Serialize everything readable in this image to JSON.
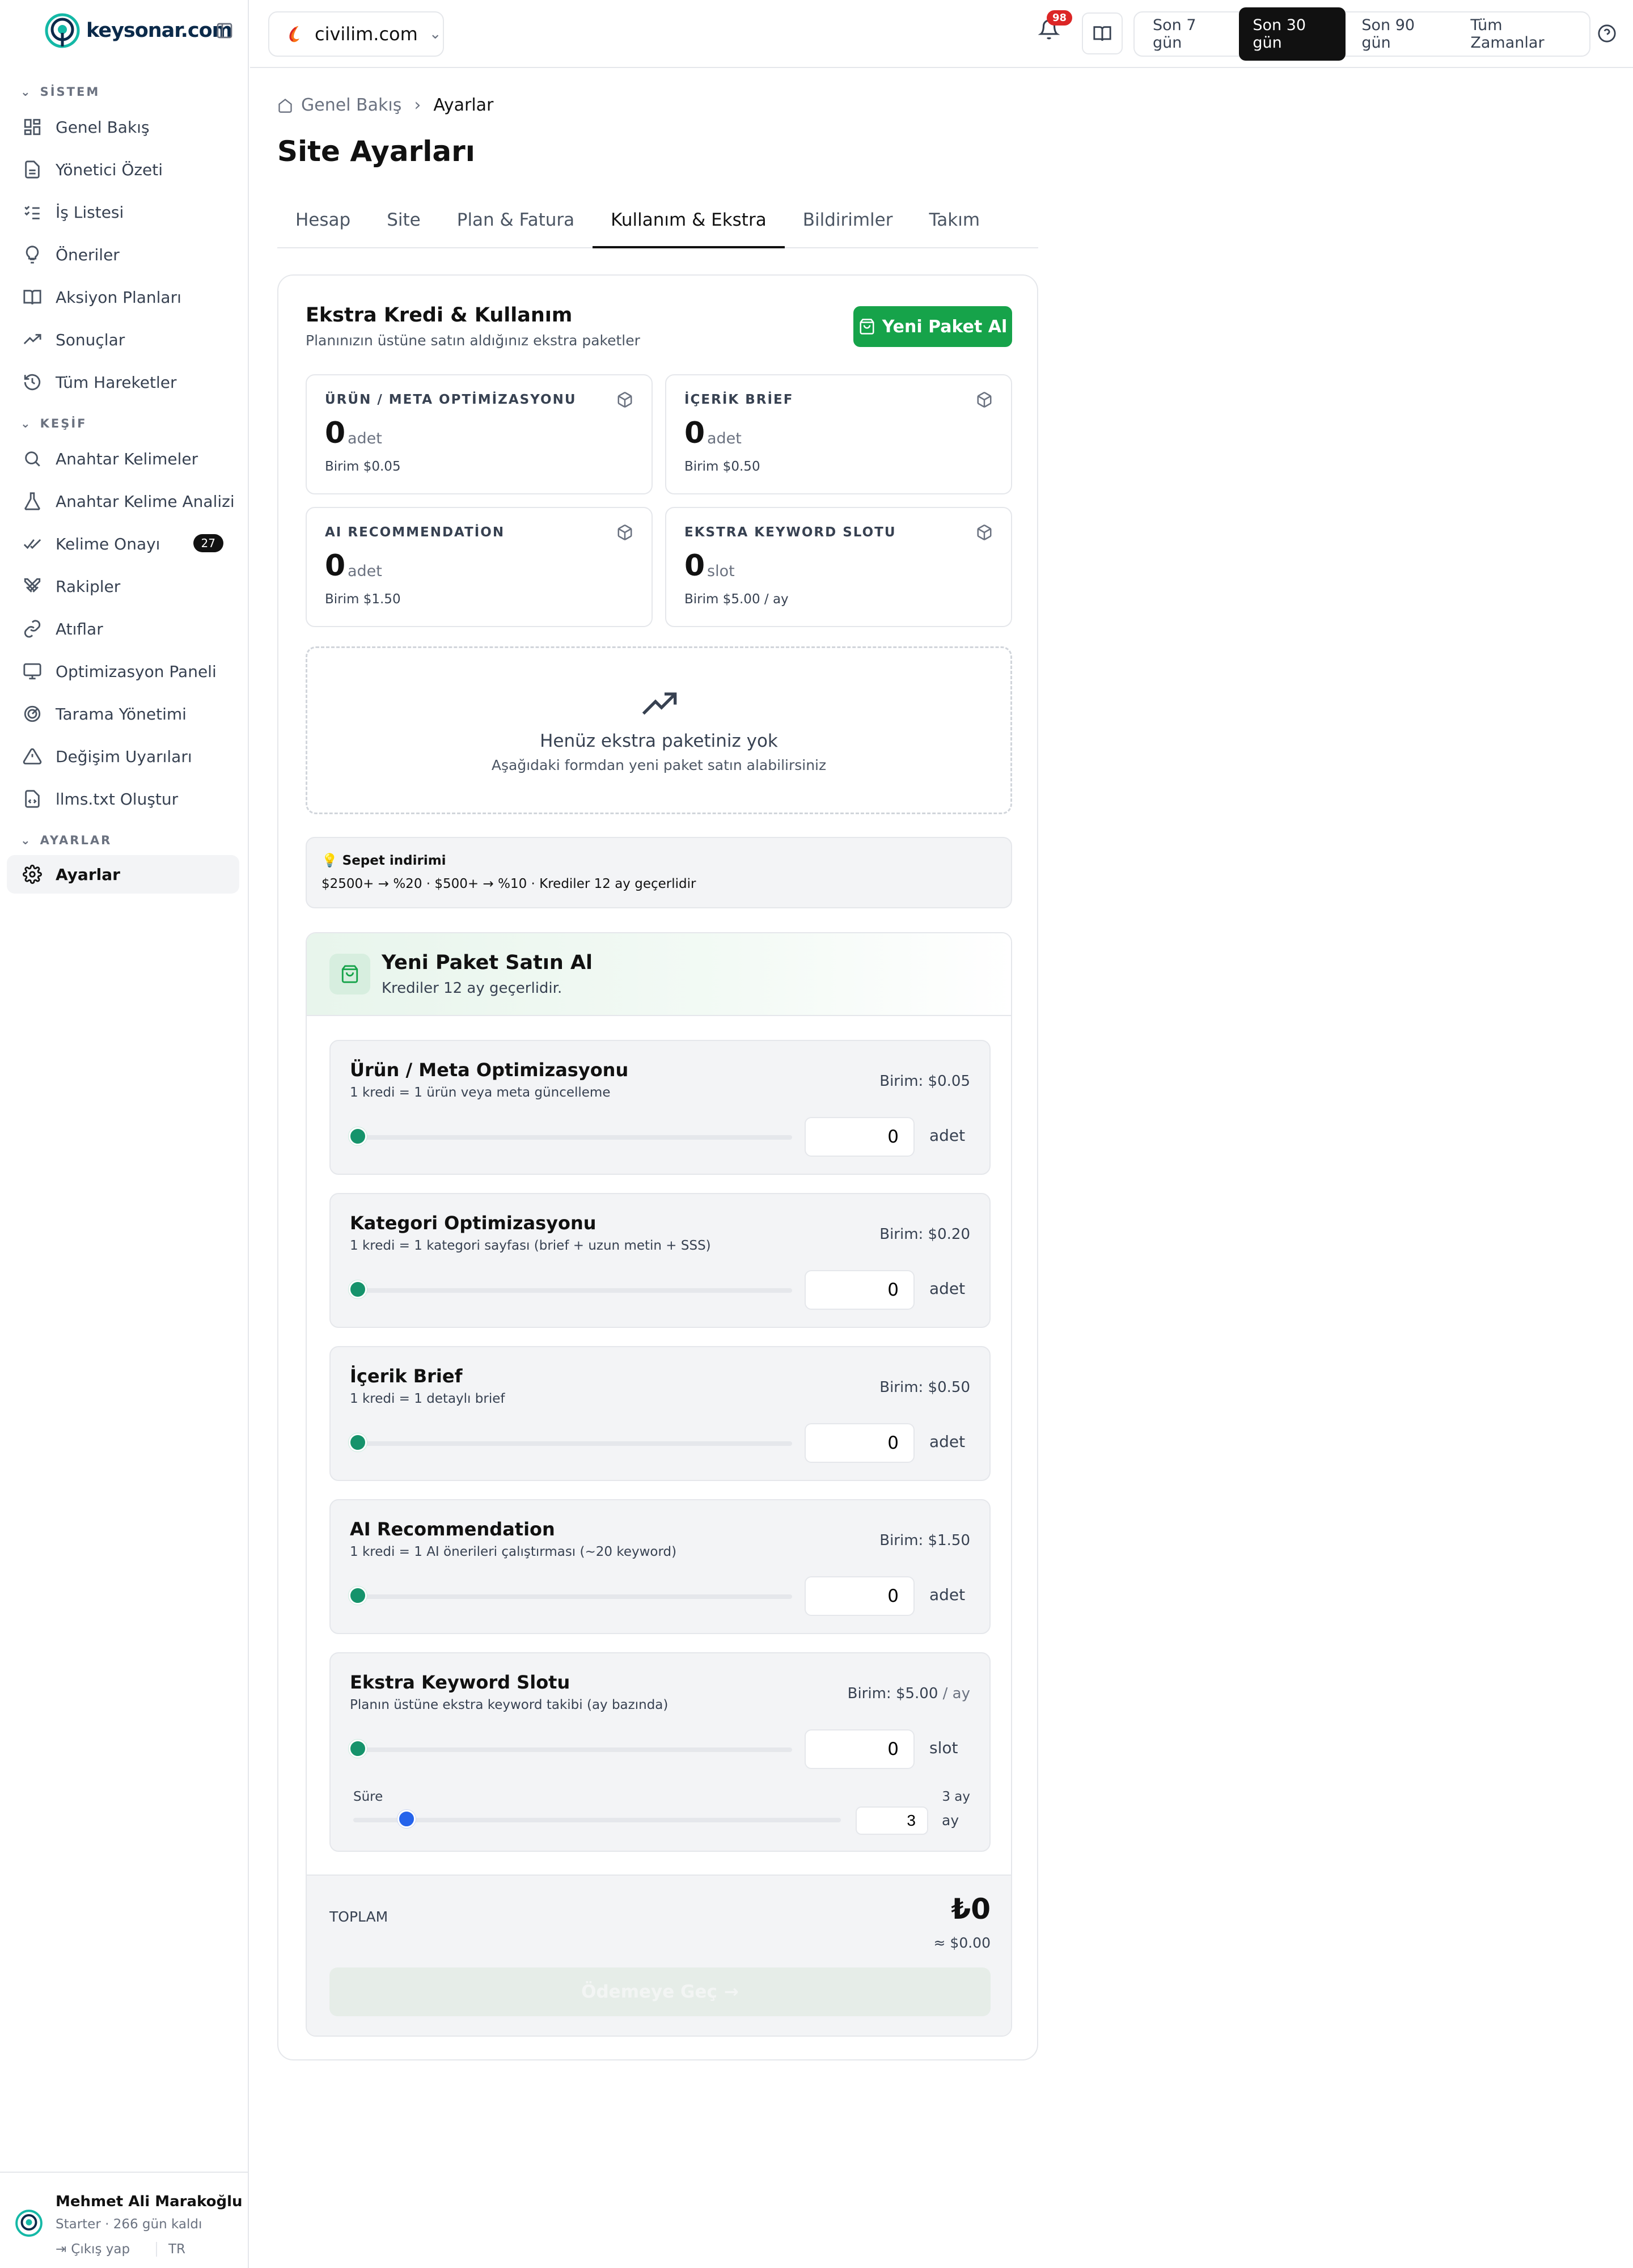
{
  "brand": {
    "name": "keysonar.com"
  },
  "sidebar": {
    "sections": [
      {
        "label": "SİSTEM"
      },
      {
        "label": "KEŞİF"
      },
      {
        "label": "AYARLAR"
      }
    ],
    "items": [
      {
        "label": "Genel Bakış"
      },
      {
        "label": "Yönetici Özeti"
      },
      {
        "label": "İş Listesi"
      },
      {
        "label": "Öneriler"
      },
      {
        "label": "Aksiyon Planları"
      },
      {
        "label": "Sonuçlar"
      },
      {
        "label": "Tüm Hareketler"
      },
      {
        "label": "Anahtar Kelimeler"
      },
      {
        "label": "Anahtar Kelime Analizi"
      },
      {
        "label": "Kelime Onayı",
        "badge": "27"
      },
      {
        "label": "Rakipler"
      },
      {
        "label": "Atıflar"
      },
      {
        "label": "Optimizasyon Paneli"
      },
      {
        "label": "Tarama Yönetimi"
      },
      {
        "label": "Değişim Uyarıları"
      },
      {
        "label": "llms.txt Oluştur"
      },
      {
        "label": "Ayarlar"
      }
    ]
  },
  "user": {
    "name": "Mehmet Ali Marakoğlu",
    "plan": "Starter · 266 gün kaldı",
    "logout": "Çıkış yap",
    "lang": "TR"
  },
  "topbar": {
    "site": "civilim.com",
    "notifications": "98",
    "ranges": [
      "Son 7 gün",
      "Son 30 gün",
      "Son 90 gün",
      "Tüm Zamanlar"
    ],
    "active_range": "Son 30 gün"
  },
  "breadcrumb": {
    "home": "Genel Bakış",
    "current": "Ayarlar"
  },
  "page": {
    "title": "Site Ayarları"
  },
  "tabs": [
    "Hesap",
    "Site",
    "Plan & Fatura",
    "Kullanım & Ekstra",
    "Bildirimler",
    "Takım"
  ],
  "active_tab": "Kullanım & Ekstra",
  "extra": {
    "title": "Ekstra Kredi & Kullanım",
    "subtitle": "Planınızın üstüne satın aldığınız ekstra paketler",
    "buy_button": "Yeni Paket Al",
    "stats": [
      {
        "label": "ÜRÜN / META OPTİMİZASYONU",
        "value": "0",
        "unit": "adet",
        "price": "Birim $0.05"
      },
      {
        "label": "İÇERİK BRİEF",
        "value": "0",
        "unit": "adet",
        "price": "Birim $0.50"
      },
      {
        "label": "AI RECOMMENDATİON",
        "value": "0",
        "unit": "adet",
        "price": "Birim $1.50"
      },
      {
        "label": "EKSTRA KEYWORD SLOTU",
        "value": "0",
        "unit": "slot",
        "price": "Birim $5.00  / ay"
      }
    ],
    "empty_title": "Henüz ekstra paketiniz yok",
    "empty_sub": "Aşağıdaki formdan yeni paket satın alabilirsiniz",
    "discount_title": "💡 Sepet indirimi",
    "discount_text": "$2500+ → %20 · $500+ → %10 · Krediler 12 ay geçerlidir"
  },
  "buy": {
    "title": "Yeni Paket Satın Al",
    "subtitle": "Krediler 12 ay geçerlidir.",
    "items": [
      {
        "name": "Ürün / Meta Optimizasyonu",
        "desc": "1 kredi = 1 ürün veya meta güncelleme",
        "price": "Birim: $0.05",
        "qty": "0",
        "unit": "adet"
      },
      {
        "name": "Kategori Optimizasyonu",
        "desc": "1 kredi = 1 kategori sayfası (brief + uzun metin + SSS)",
        "price": "Birim: $0.20",
        "qty": "0",
        "unit": "adet"
      },
      {
        "name": "İçerik Brief",
        "desc": "1 kredi = 1 detaylı brief",
        "price": "Birim: $0.50",
        "qty": "0",
        "unit": "adet"
      },
      {
        "name": "AI Recommendation",
        "desc": "1 kredi = 1 AI önerileri çalıştırması (~20 keyword)",
        "price": "Birim: $1.50",
        "qty": "0",
        "unit": "adet"
      },
      {
        "name": "Ekstra Keyword Slotu",
        "desc": "Planın üstüne ekstra keyword takibi (ay bazında)",
        "price": "Birim: $5.00",
        "price_suffix": "/ ay",
        "qty": "0",
        "unit": "slot"
      }
    ],
    "duration_label": "Süre",
    "duration_value": "3 ay",
    "duration_qty": "3",
    "duration_unit": "ay",
    "total_label": "TOPLAM",
    "total_try": "₺0",
    "total_usd": "≈ $0.00",
    "pay_button": "Ödemeye Geç"
  },
  "colors": {
    "accent_green": "#16a34a",
    "slider_green": "#15936b",
    "slider_blue": "#2563eb",
    "badge_red": "#dc2626"
  }
}
